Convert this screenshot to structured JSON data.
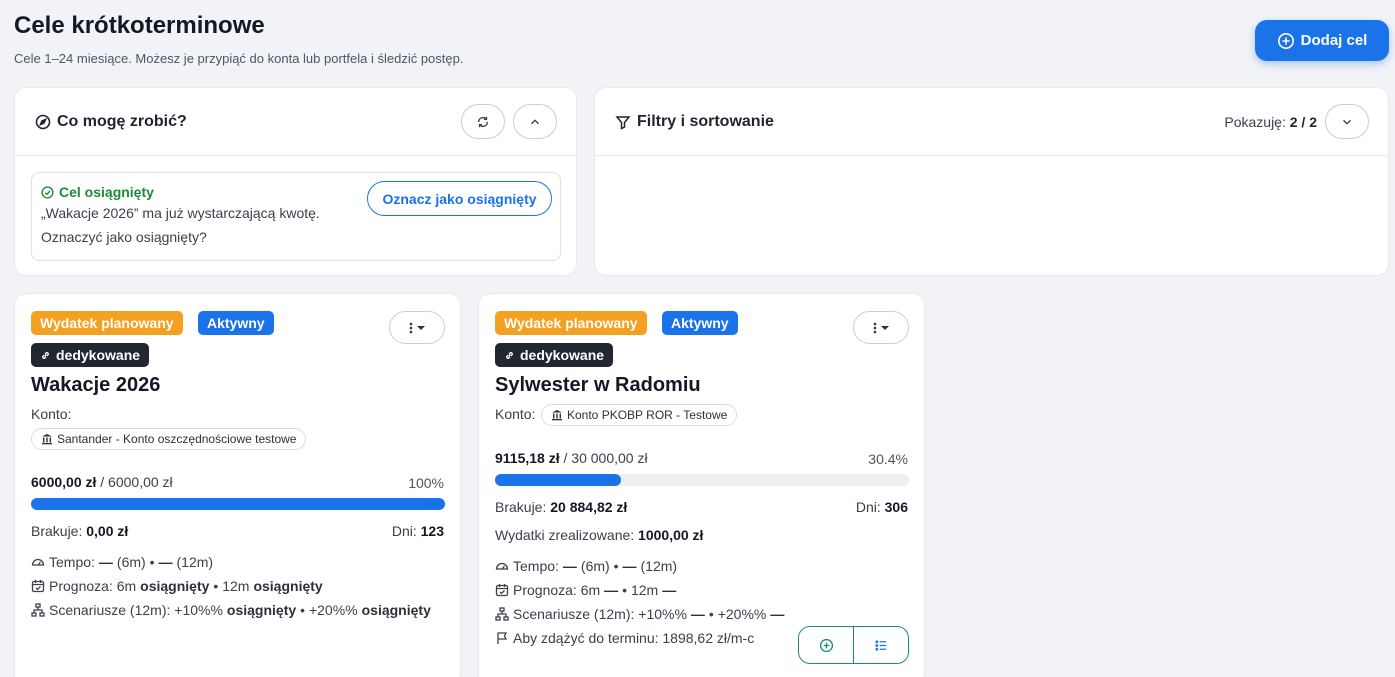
{
  "header": {
    "title": "Cele krótkoterminowe",
    "subtitle": "Cele 1–24 miesiące. Możesz je przypiąć do konta lub portfela i śledzić postęp.",
    "add_button": "Dodaj cel"
  },
  "suggestions": {
    "title": "Co mogę zrobić?",
    "tip": {
      "title": "Cel osiągnięty",
      "text": "„Wakacje 2026” ma już wystarczającą kwotę. Oznaczyć jako osiągnięty?",
      "button": "Oznacz jako osiągnięty"
    }
  },
  "filters": {
    "title": "Filtry i sortowanie",
    "count_label": "Pokazuję:",
    "count_value": "2 / 2"
  },
  "goals": [
    {
      "type_badge": "Wydatek planowany",
      "status_badge": "Aktywny",
      "link_badge": "dedykowane",
      "name": "Wakacje 2026",
      "konto_label": "Konto:",
      "account": "Santander - Konto oszczędnościowe testowe",
      "current": "6000,00 zł",
      "target": "/ 6000,00 zł",
      "percent_label": "100%",
      "progress": 1.0,
      "missing_label": "Brakuje:",
      "missing_value": "0,00 zł",
      "days_label": "Dni:",
      "days_value": "123",
      "tempo": {
        "label": "Tempo:",
        "v1": "—",
        "p1": "(6m) •",
        "v2": "—",
        "p2": "(12m)"
      },
      "forecast": {
        "label": "Prognoza: 6m",
        "v1": "osiągnięty",
        "mid": "• 12m",
        "v2": "osiągnięty"
      },
      "scenarios": {
        "label": "Scenariusze (12m): +10%%",
        "v1": "osiągnięty",
        "mid": "• +20%%",
        "v2": "osiągnięty"
      }
    },
    {
      "type_badge": "Wydatek planowany",
      "status_badge": "Aktywny",
      "link_badge": "dedykowane",
      "name": "Sylwester w Radomiu",
      "konto_label": "Konto:",
      "account": "Konto PKOBP ROR - Testowe",
      "current": "9115,18 zł",
      "target": "/ 30 000,00 zł",
      "percent_label": "30.4%",
      "progress": 0.304,
      "missing_label": "Brakuje:",
      "missing_value": "20 884,82 zł",
      "days_label": "Dni:",
      "days_value": "306",
      "realized_label": "Wydatki zrealizowane:",
      "realized_value": "1000,00 zł",
      "tempo": {
        "label": "Tempo:",
        "v1": "—",
        "p1": "(6m) •",
        "v2": "—",
        "p2": "(12m)"
      },
      "forecast": {
        "label": "Prognoza: 6m",
        "v1": "—",
        "mid": "• 12m",
        "v2": "—"
      },
      "scenarios": {
        "label": "Scenariusze (12m): +10%%",
        "v1": "—",
        "mid": "• +20%%",
        "v2": "—"
      },
      "deadline": "Aby zdążyć do terminu: 1898,62 zł/m-c"
    }
  ],
  "colors": {
    "accent": "#1a73e8",
    "success": "#1f8a3b",
    "badge_orange": "#f4a020",
    "badge_dark": "#22262e",
    "action_teal": "#1f8a7a"
  }
}
